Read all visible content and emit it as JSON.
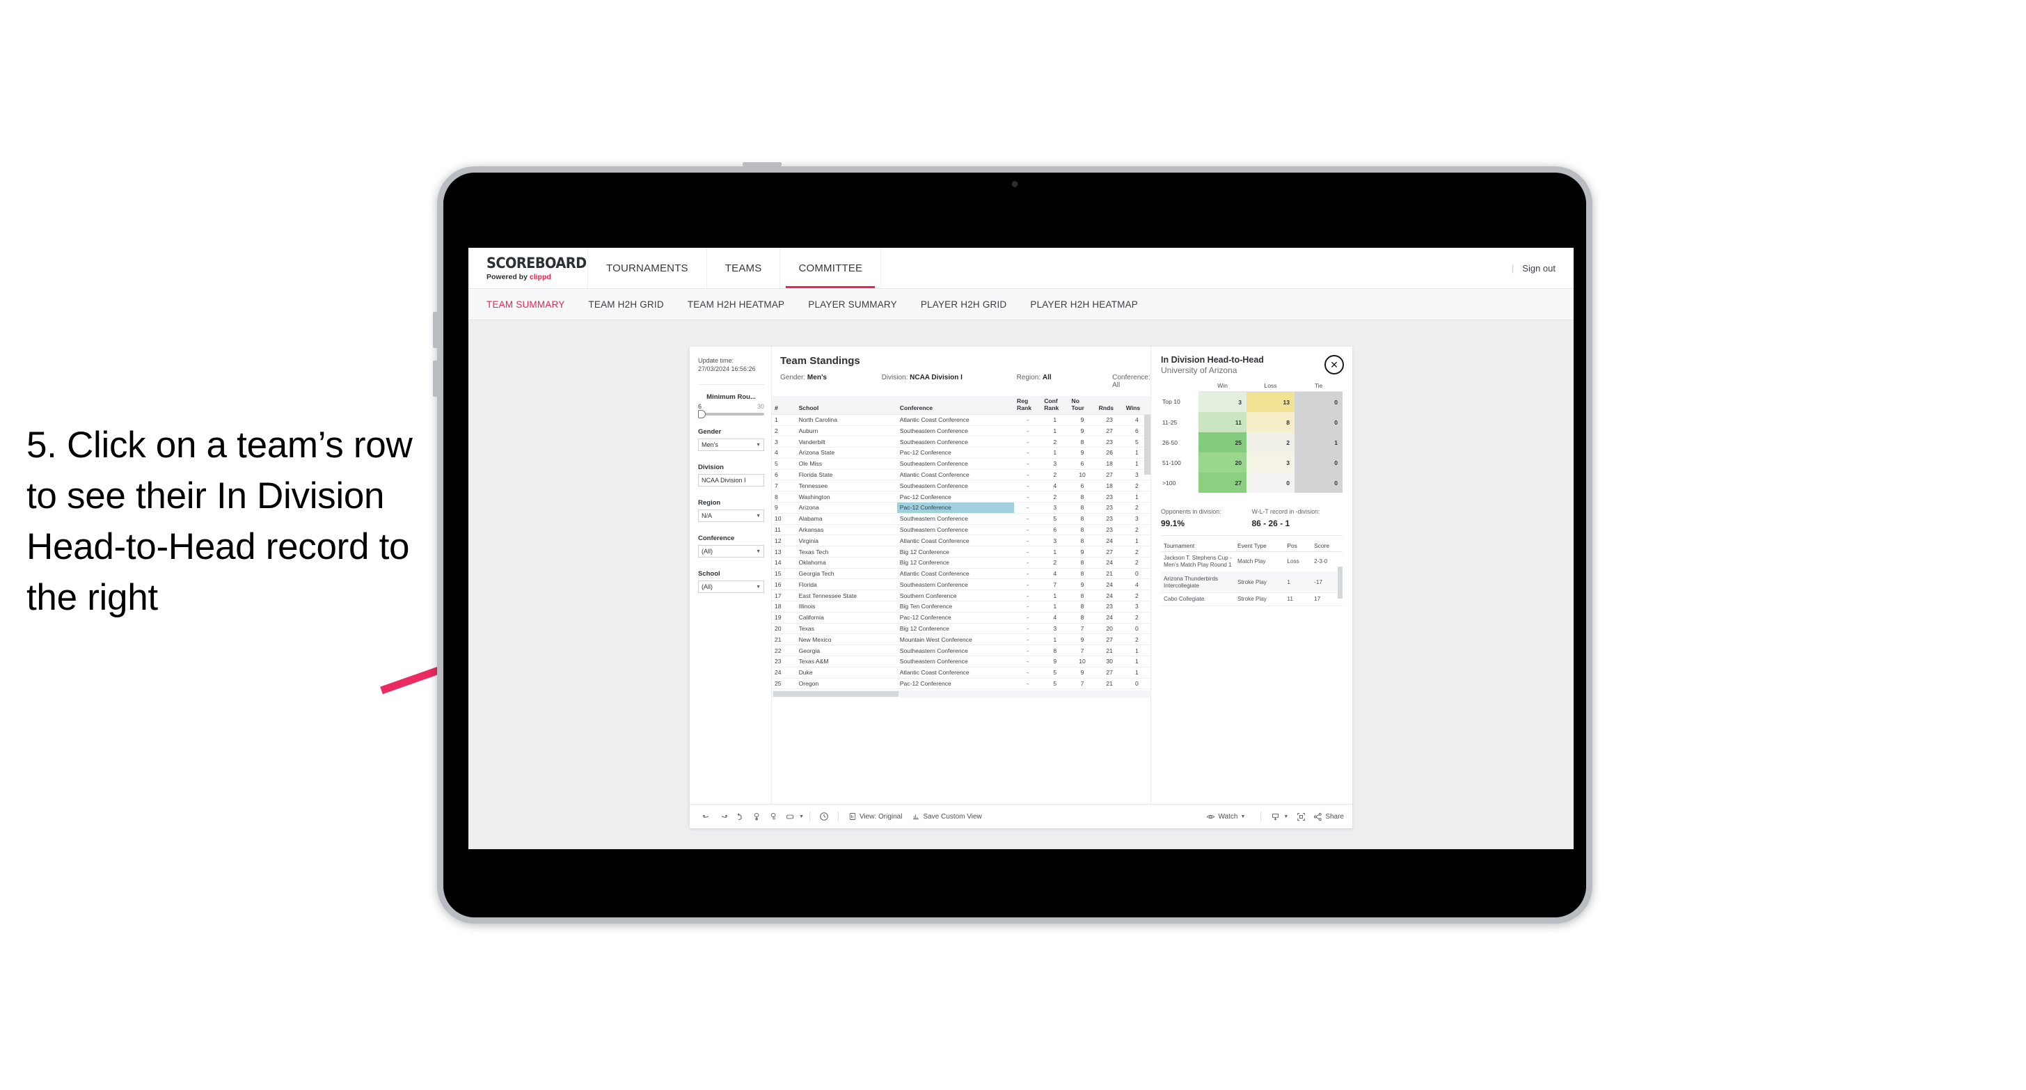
{
  "annotation": {
    "text": "5. Click on a team’s row to see their In Division Head-to-Head record to the right",
    "arrow_color": "#ec2a62"
  },
  "app": {
    "brand": {
      "title": "SCOREBOARD",
      "powered_prefix": "Powered by",
      "powered_name": "clippd"
    },
    "nav": [
      {
        "label": "TOURNAMENTS",
        "active": false
      },
      {
        "label": "TEAMS",
        "active": false
      },
      {
        "label": "COMMITTEE",
        "active": true
      }
    ],
    "sign_out": "Sign out",
    "nav_divider": "|",
    "subnav": [
      {
        "label": "TEAM SUMMARY",
        "active": true
      },
      {
        "label": "TEAM H2H GRID",
        "active": false
      },
      {
        "label": "TEAM H2H HEATMAP",
        "active": false
      },
      {
        "label": "PLAYER SUMMARY",
        "active": false
      },
      {
        "label": "PLAYER H2H GRID",
        "active": false
      },
      {
        "label": "PLAYER H2H HEATMAP",
        "active": false
      }
    ]
  },
  "filters": {
    "update_label": "Update time:",
    "update_value": "27/03/2024 16:56:26",
    "slider": {
      "title": "Minimum Rou...",
      "min": "6",
      "max": "30"
    },
    "groups": [
      {
        "label": "Gender",
        "value": "Men’s"
      },
      {
        "label": "Division",
        "value": "NCAA Division I"
      },
      {
        "label": "Region",
        "value": "N/A"
      },
      {
        "label": "Conference",
        "value": "(All)"
      },
      {
        "label": "School",
        "value": "(All)"
      }
    ]
  },
  "standings": {
    "title": "Team Standings",
    "summary": [
      {
        "label": "Gender:",
        "value": "Men’s"
      },
      {
        "label": "Division:",
        "value": "NCAA Division I"
      },
      {
        "label": "Region:",
        "value": "All"
      },
      {
        "label": "Conference:",
        "value": "All"
      }
    ],
    "columns": [
      "#",
      "School",
      "Conference",
      "Reg Rank",
      "Conf Rank",
      "No Tour",
      "Rnds",
      "Wins"
    ],
    "selected_row_index": 8,
    "rows": [
      [
        "1",
        "North Carolina",
        "Atlantic Coast Conference",
        "-",
        "1",
        "9",
        "23",
        "4"
      ],
      [
        "2",
        "Auburn",
        "Southeastern Conference",
        "-",
        "1",
        "9",
        "27",
        "6"
      ],
      [
        "3",
        "Vanderbilt",
        "Southeastern Conference",
        "-",
        "2",
        "8",
        "23",
        "5"
      ],
      [
        "4",
        "Arizona State",
        "Pac-12 Conference",
        "-",
        "1",
        "9",
        "26",
        "1"
      ],
      [
        "5",
        "Ole Miss",
        "Southeastern Conference",
        "-",
        "3",
        "6",
        "18",
        "1"
      ],
      [
        "6",
        "Florida State",
        "Atlantic Coast Conference",
        "-",
        "2",
        "10",
        "27",
        "3"
      ],
      [
        "7",
        "Tennessee",
        "Southeastern Conference",
        "-",
        "4",
        "6",
        "18",
        "2"
      ],
      [
        "8",
        "Washington",
        "Pac-12 Conference",
        "-",
        "2",
        "8",
        "23",
        "1"
      ],
      [
        "9",
        "Arizona",
        "Pac-12 Conference",
        "-",
        "3",
        "8",
        "23",
        "2"
      ],
      [
        "10",
        "Alabama",
        "Southeastern Conference",
        "-",
        "5",
        "8",
        "23",
        "3"
      ],
      [
        "11",
        "Arkansas",
        "Southeastern Conference",
        "-",
        "6",
        "8",
        "23",
        "2"
      ],
      [
        "12",
        "Virginia",
        "Atlantic Coast Conference",
        "-",
        "3",
        "8",
        "24",
        "1"
      ],
      [
        "13",
        "Texas Tech",
        "Big 12 Conference",
        "-",
        "1",
        "9",
        "27",
        "2"
      ],
      [
        "14",
        "Oklahoma",
        "Big 12 Conference",
        "-",
        "2",
        "8",
        "24",
        "2"
      ],
      [
        "15",
        "Georgia Tech",
        "Atlantic Coast Conference",
        "-",
        "4",
        "8",
        "21",
        "0"
      ],
      [
        "16",
        "Florida",
        "Southeastern Conference",
        "-",
        "7",
        "9",
        "24",
        "4"
      ],
      [
        "17",
        "East Tennessee State",
        "Southern Conference",
        "-",
        "1",
        "8",
        "24",
        "2"
      ],
      [
        "18",
        "Illinois",
        "Big Ten Conference",
        "-",
        "1",
        "8",
        "23",
        "3"
      ],
      [
        "19",
        "California",
        "Pac-12 Conference",
        "-",
        "4",
        "8",
        "24",
        "2"
      ],
      [
        "20",
        "Texas",
        "Big 12 Conference",
        "-",
        "3",
        "7",
        "20",
        "0"
      ],
      [
        "21",
        "New Mexico",
        "Mountain West Conference",
        "-",
        "1",
        "9",
        "27",
        "2"
      ],
      [
        "22",
        "Georgia",
        "Southeastern Conference",
        "-",
        "8",
        "7",
        "21",
        "1"
      ],
      [
        "23",
        "Texas A&M",
        "Southeastern Conference",
        "-",
        "9",
        "10",
        "30",
        "1"
      ],
      [
        "24",
        "Duke",
        "Atlantic Coast Conference",
        "-",
        "5",
        "9",
        "27",
        "1"
      ],
      [
        "25",
        "Oregon",
        "Pac-12 Conference",
        "-",
        "5",
        "7",
        "21",
        "0"
      ]
    ]
  },
  "h2h": {
    "title": "In Division Head-to-Head",
    "subtitle": "University of Arizona",
    "close_icon": "close-icon",
    "columns": [
      "",
      "Win",
      "Loss",
      "Tie"
    ],
    "rows": [
      {
        "label": "Top 10",
        "win": "3",
        "loss": "13",
        "tie": "0",
        "win_color": "#e3f0e0",
        "loss_color": "#f1e294",
        "tie_color": "#d2d3d4"
      },
      {
        "label": "11-25",
        "win": "11",
        "loss": "8",
        "tie": "0",
        "win_color": "#cae6c1",
        "loss_color": "#f6eec9",
        "tie_color": "#d2d3d4"
      },
      {
        "label": "26-50",
        "win": "25",
        "loss": "2",
        "tie": "1",
        "win_color": "#84cc7d",
        "loss_color": "#f1f0e8",
        "tie_color": "#d2d3d4"
      },
      {
        "label": "51-100",
        "win": "20",
        "loss": "3",
        "tie": "0",
        "win_color": "#9bd68f",
        "loss_color": "#f5f2e6",
        "tie_color": "#d2d3d4"
      },
      {
        "label": ">100",
        "win": "27",
        "loss": "0",
        "tie": "0",
        "win_color": "#8ccf80",
        "loss_color": "#f3f3f1",
        "tie_color": "#d2d3d4"
      }
    ],
    "stats": [
      {
        "label": "Opponents in division:",
        "value": "99.1%"
      },
      {
        "label": "W-L-T record in -division:",
        "value": "86 - 26 - 1"
      }
    ],
    "tournament_columns": [
      "Tournament",
      "Event Type",
      "Pos",
      "Score"
    ],
    "tournaments": [
      [
        "Jackson T. Stephens Cup - Men’s Match Play Round 1",
        "Match Play",
        "Loss",
        "2-3-0"
      ],
      [
        "Arizona Thunderbirds Intercollegiate",
        "Stroke Play",
        "1",
        "-17"
      ],
      [
        "Cabo Collegiate",
        "Stroke Play",
        "11",
        "17"
      ]
    ]
  },
  "toolbar": {
    "view_label": "View: Original",
    "save_label": "Save Custom View",
    "watch_label": "Watch",
    "share_label": "Share"
  }
}
